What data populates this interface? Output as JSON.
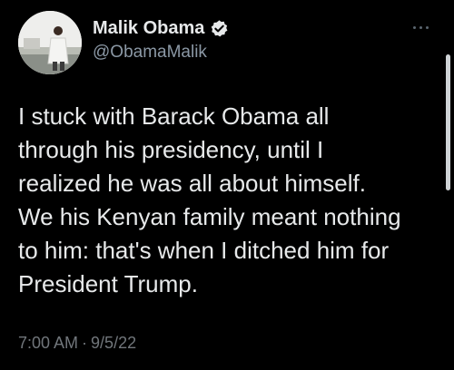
{
  "author": {
    "display_name": "Malik Obama",
    "handle": "@ObamaMalik",
    "verified": true,
    "avatar": "profile-photo"
  },
  "tweet": {
    "text": "I stuck with Barack Obama all\nthrough his presidency, until I\nrealized he was all about himself.\nWe his Kenyan family meant nothing\nto him: that's when I ditched him for\nPresident Trump."
  },
  "meta": {
    "time": "7:00 AM",
    "separator": "·",
    "date": "9/5/22"
  },
  "icons": {
    "verified": "verified-badge-icon",
    "more": "more-options-icon"
  },
  "colors": {
    "background": "#000000",
    "primary_text": "#e7e9ea",
    "secondary_text": "#71767b",
    "verified_badge": "#e7e9ea"
  }
}
